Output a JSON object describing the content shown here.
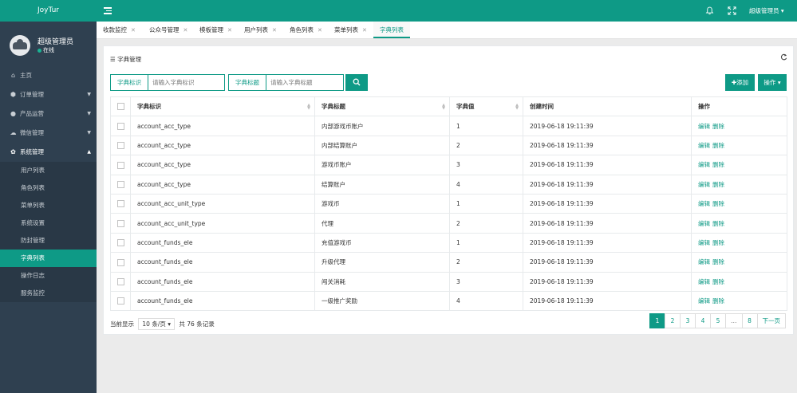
{
  "app": {
    "logo": "JoyTur"
  },
  "user": {
    "name": "超级管理员",
    "status": "在线"
  },
  "menu": [
    {
      "label": "主页",
      "icon": "home-icon"
    },
    {
      "label": "订单管理",
      "icon": "cube-icon"
    },
    {
      "label": "产品运营",
      "icon": "rocket-icon"
    },
    {
      "label": "微信管理",
      "icon": "wechat-icon"
    },
    {
      "label": "系统管理",
      "icon": "gear-icon"
    }
  ],
  "submenu": [
    {
      "label": "用户列表"
    },
    {
      "label": "角色列表"
    },
    {
      "label": "菜单列表"
    },
    {
      "label": "系统设置"
    },
    {
      "label": "防封管理"
    },
    {
      "label": "字典列表",
      "active": true
    },
    {
      "label": "操作日志"
    },
    {
      "label": "服务监控"
    }
  ],
  "header": {
    "admin_label": "超级管理员"
  },
  "tabs": [
    {
      "label": "收款监控"
    },
    {
      "label": "公众号管理"
    },
    {
      "label": "模板管理"
    },
    {
      "label": "用户列表"
    },
    {
      "label": "角色列表"
    },
    {
      "label": "菜单列表"
    },
    {
      "label": "字典列表",
      "active": true
    }
  ],
  "panel": {
    "title": "字典管理"
  },
  "search": {
    "field1_label": "字典标识",
    "field1_placeholder": "请输入字典标识",
    "field2_label": "字典标题",
    "field2_placeholder": "请输入字典标题"
  },
  "buttons": {
    "add": "添加",
    "ops": "操作"
  },
  "table": {
    "columns": [
      "字典标识",
      "字典标题",
      "字典值",
      "创建时间",
      "操作"
    ],
    "actions": {
      "edit": "编辑",
      "delete": "删除"
    },
    "rows": [
      {
        "key": "account_acc_type",
        "title": "内部游戏币账户",
        "value": "1",
        "created": "2019-06-18 19:11:39"
      },
      {
        "key": "account_acc_type",
        "title": "内部结算账户",
        "value": "2",
        "created": "2019-06-18 19:11:39"
      },
      {
        "key": "account_acc_type",
        "title": "游戏币账户",
        "value": "3",
        "created": "2019-06-18 19:11:39"
      },
      {
        "key": "account_acc_type",
        "title": "结算账户",
        "value": "4",
        "created": "2019-06-18 19:11:39"
      },
      {
        "key": "account_acc_unit_type",
        "title": "游戏币",
        "value": "1",
        "created": "2019-06-18 19:11:39"
      },
      {
        "key": "account_acc_unit_type",
        "title": "代理",
        "value": "2",
        "created": "2019-06-18 19:11:39"
      },
      {
        "key": "account_funds_ele",
        "title": "充值游戏币",
        "value": "1",
        "created": "2019-06-18 19:11:39"
      },
      {
        "key": "account_funds_ele",
        "title": "升级代理",
        "value": "2",
        "created": "2019-06-18 19:11:39"
      },
      {
        "key": "account_funds_ele",
        "title": "闯关消耗",
        "value": "3",
        "created": "2019-06-18 19:11:39"
      },
      {
        "key": "account_funds_ele",
        "title": "一级推广奖励",
        "value": "4",
        "created": "2019-06-18 19:11:39"
      }
    ]
  },
  "footer": {
    "showing_label": "当前显示",
    "page_size": "10 条/页",
    "total_text": "共 76 条记录"
  },
  "pagination": {
    "pages": [
      "1",
      "2",
      "3",
      "4",
      "5",
      "…",
      "8"
    ],
    "current": "1",
    "next": "下一页"
  },
  "colors": {
    "accent": "#0e9a86",
    "sidebar": "#2f4050"
  }
}
